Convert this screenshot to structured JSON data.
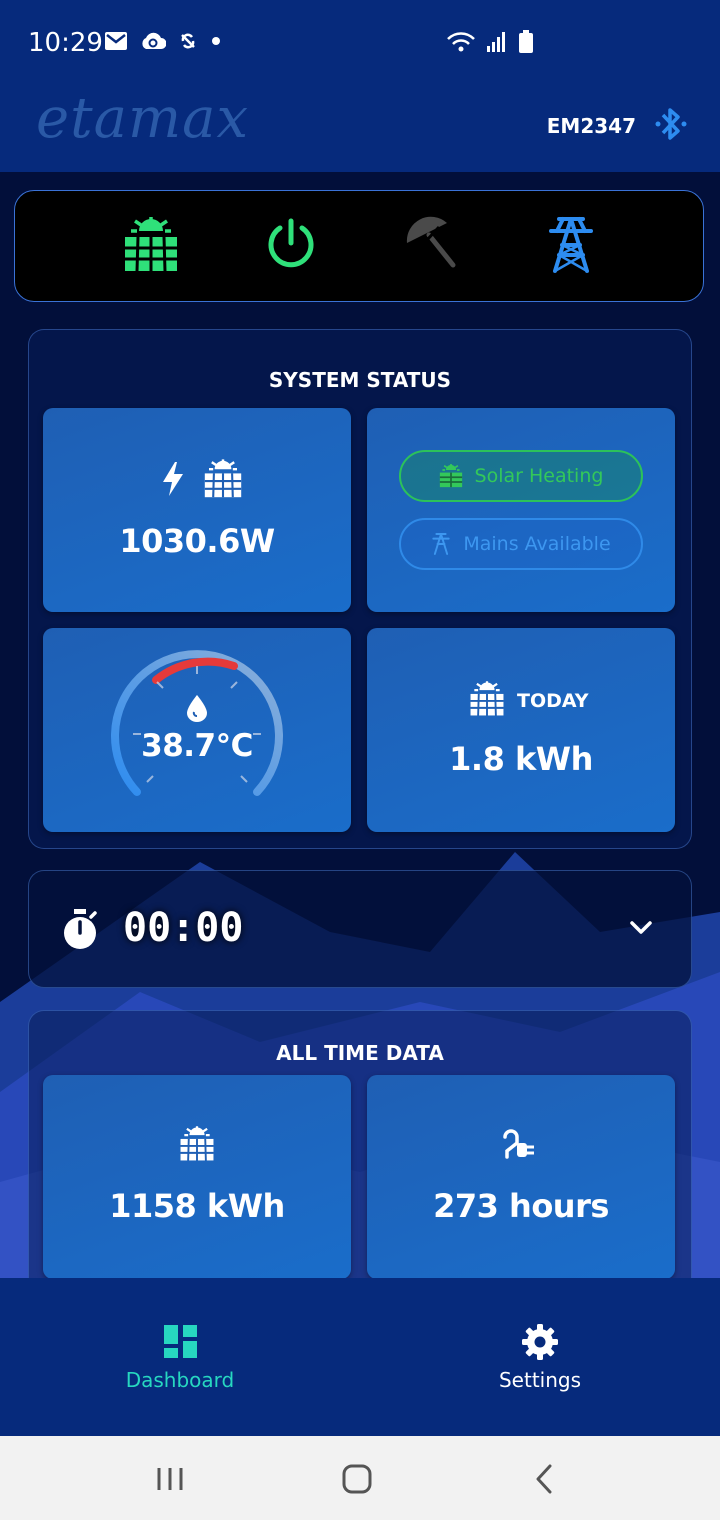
{
  "status_bar": {
    "time": "10:29",
    "left_icons": [
      "mail-icon",
      "cloud-sync-icon",
      "no-sync-icon",
      "dot-icon"
    ],
    "right_icons": [
      "wifi-icon",
      "signal-icon",
      "battery-icon"
    ]
  },
  "app_bar": {
    "logo_text": "etamax",
    "device_id": "EM2347",
    "bluetooth_icon": "bluetooth-icon"
  },
  "mode_bar": {
    "modes": [
      {
        "icon": "solar-panel-icon",
        "color": "#2fe07a"
      },
      {
        "icon": "power-icon",
        "color": "#2fe07a"
      },
      {
        "icon": "umbrella-off-icon",
        "color": "#4a4a4a"
      },
      {
        "icon": "pylon-icon",
        "color": "#2d8cf0"
      }
    ]
  },
  "system_status": {
    "title": "SYSTEM STATUS",
    "solar_power": "1030.6W",
    "status_pills": [
      {
        "label": "Solar Heating",
        "state": "active",
        "color": "#2cc25a"
      },
      {
        "label": "Mains Available",
        "state": "available",
        "color": "#2f8ae8"
      }
    ],
    "temperature": "38.7°C",
    "temperature_gauge_fraction": 0.35,
    "today_label": "TODAY",
    "today_energy": "1.8 kWh"
  },
  "timer": {
    "value": "00:00"
  },
  "all_time_data": {
    "title": "ALL TIME DATA",
    "solar_energy": "1158 kWh",
    "mains_hours": "273 hours"
  },
  "bottom_nav": {
    "items": [
      {
        "label": "Dashboard",
        "active": true,
        "color": "#27d7c0"
      },
      {
        "label": "Settings",
        "active": false,
        "color": "#ffffff"
      }
    ]
  },
  "system_nav": [
    "recents-button",
    "home-button",
    "back-button"
  ],
  "colors": {
    "app_bar": "#062a7c",
    "tile": "#1a6dca",
    "accent_green": "#2fe07a",
    "accent_blue": "#2d8cf0",
    "gauge_red": "#e53a3a"
  }
}
